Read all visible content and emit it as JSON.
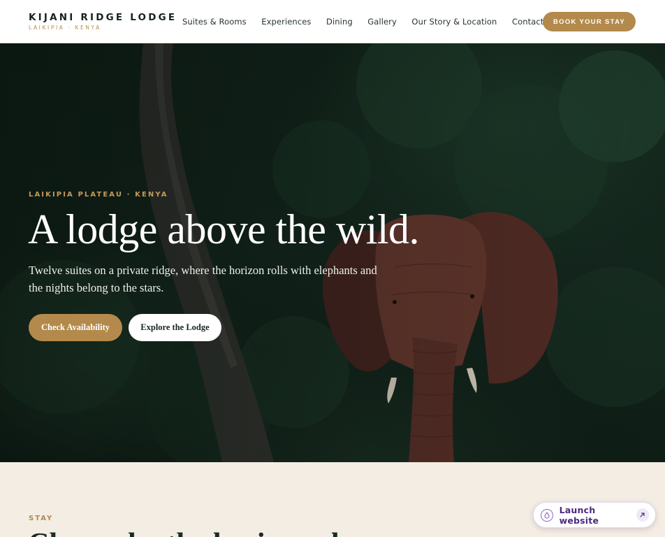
{
  "header": {
    "brand_name": "KIJANI RIDGE LODGE",
    "brand_sub": "LAIKIPIA · KENYA",
    "nav": [
      {
        "label": "Suites & Rooms"
      },
      {
        "label": "Experiences"
      },
      {
        "label": "Dining"
      },
      {
        "label": "Gallery"
      },
      {
        "label": "Our Story & Location"
      },
      {
        "label": "Contact"
      }
    ],
    "book_label": "BOOK YOUR STAY"
  },
  "hero": {
    "eyebrow": "LAIKIPIA PLATEAU · KENYA",
    "title": "A lodge above the wild.",
    "text": "Twelve suites on a private ridge, where the horizon rolls with elephants and the nights belong to the stars.",
    "primary_cta": "Check Availability",
    "secondary_cta": "Explore the Lodge"
  },
  "section": {
    "eyebrow": "STAY",
    "title": "Chosen by the horizon alone"
  },
  "launch": {
    "label": "Launch website",
    "logo_icon": "drop-logo-icon",
    "arrow_icon": "arrow-up-right-icon"
  },
  "colors": {
    "accent": "#b38a4b",
    "header_bg": "#ffffff",
    "section_bg": "#f3ede3",
    "launch_text": "#4b2a80"
  }
}
